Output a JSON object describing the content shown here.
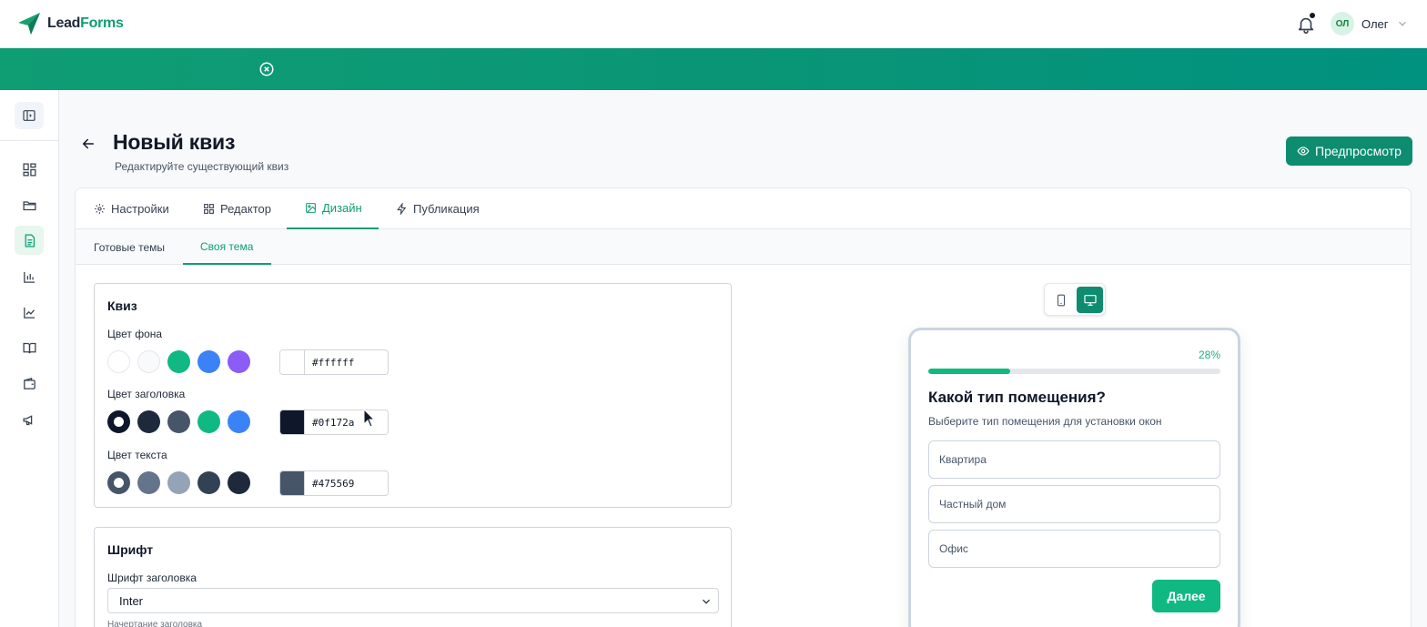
{
  "app": {
    "logo_lead": "Lead",
    "logo_forms": "Forms",
    "user_initials": "ОЛ",
    "user_name": "Олег"
  },
  "page": {
    "title": "Новый квиз",
    "subtitle": "Редактируйте существующий квиз",
    "preview_button": "Предпросмотр"
  },
  "tabs": [
    {
      "label": "Настройки",
      "icon": "gear-icon"
    },
    {
      "label": "Редактор",
      "icon": "grid-icon"
    },
    {
      "label": "Дизайн",
      "icon": "image-icon",
      "active": true
    },
    {
      "label": "Публикация",
      "icon": "lightning-icon"
    }
  ],
  "subtabs": [
    {
      "label": "Готовые темы"
    },
    {
      "label": "Своя тема",
      "active": true
    }
  ],
  "sidebar": {
    "items": [
      "dashboard-icon",
      "folder-icon",
      "document-icon",
      "bar-chart-icon",
      "line-chart-icon",
      "book-icon",
      "wallet-icon",
      "megaphone-icon"
    ],
    "active_index": 2
  },
  "quiz_section": {
    "title": "Квиз",
    "bg": {
      "label": "Цвет фона",
      "swatches": [
        "#ffffff",
        "#f8fafc",
        "#10b981",
        "#3b82f6",
        "#8b5cf6"
      ],
      "value": "#ffffff"
    },
    "heading": {
      "label": "Цвет заголовка",
      "swatches": [
        "#0f172a",
        "#1e293b",
        "#475569",
        "#10b981",
        "#3b82f6"
      ],
      "selected_index": 0,
      "value": "#0f172a"
    },
    "text": {
      "label": "Цвет текста",
      "swatches": [
        "#475569",
        "#64748b",
        "#94a3b8",
        "#334155",
        "#1e293b"
      ],
      "selected_index": 0,
      "value": "#475569"
    }
  },
  "font_section": {
    "title": "Шрифт",
    "heading_font_label": "Шрифт заголовка",
    "heading_font_value": "Inter",
    "heading_style_label": "Начертание заголовка"
  },
  "preview": {
    "progress_label": "28%",
    "progress": 0.28,
    "question": "Какой тип помещения?",
    "hint": "Выберите тип помещения для установки окон",
    "options": [
      "Квартира",
      "Частный дом",
      "Офис"
    ],
    "next_button": "Далее"
  },
  "colors": {
    "brand": "#0f9d74",
    "accent_green": "#10b981"
  }
}
